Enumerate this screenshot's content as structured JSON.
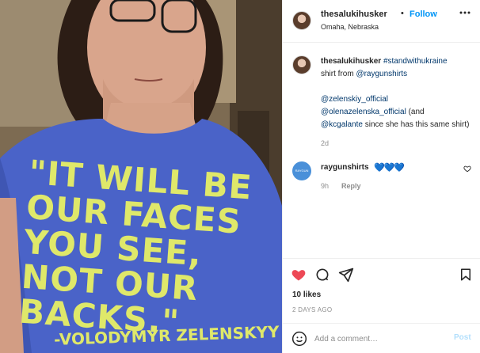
{
  "header": {
    "username": "thesalukihusker",
    "separator": "•",
    "follow_label": "Follow",
    "location": "Omaha, Nebraska",
    "more_icon": "more-horizontal-icon"
  },
  "photo": {
    "shirt_lines": [
      "\"IT WILL BE",
      "OUR FACES",
      "YOU SEE,",
      "NOT OUR",
      "BACKS.\""
    ],
    "shirt_attribution": "-VOLODYMYR ZELENSKYY",
    "shirt_color": "#4a63c8",
    "text_color": "#dfe86a"
  },
  "caption": {
    "username": "thesalukihusker",
    "hashtag": "#standwithukraine",
    "text1": "shirt from",
    "mention1": "@raygunshirts",
    "mention2": "@zelenskiy_official",
    "mention3": "@olenazelenska_official",
    "text2": "(and",
    "mention4": "@kcgalante",
    "text3": "since she has this same shirt)",
    "time": "2d"
  },
  "comment": {
    "avatar_text": "RAYGUN",
    "username": "raygunshirts",
    "text": "💙💙💙",
    "time": "9h",
    "reply_label": "Reply"
  },
  "actions": {
    "likes": "10 likes",
    "date": "2 DAYS AGO",
    "like_color": "#ed4956"
  },
  "add_comment": {
    "placeholder": "Add a comment…",
    "post_label": "Post"
  }
}
